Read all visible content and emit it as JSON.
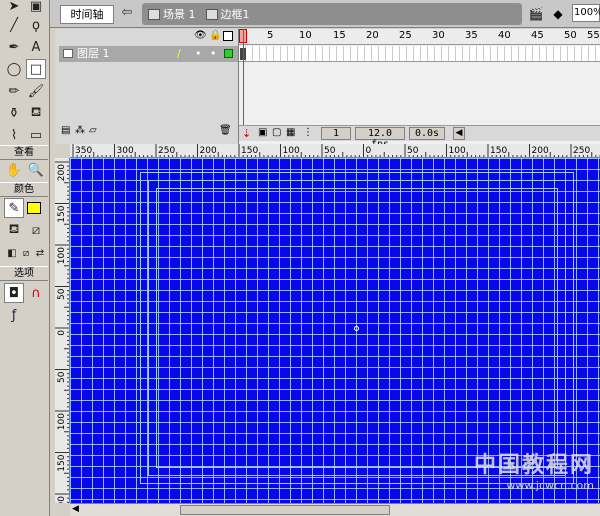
{
  "header": {
    "timeline_button": "时间轴",
    "scene_label": "场景 1",
    "symbol_label": "边框1",
    "zoom": "100%"
  },
  "tools": {
    "view_label": "查看",
    "colors_label": "颜色",
    "options_label": "选项",
    "stroke_color": "#000000",
    "fill_color": "#ffff00"
  },
  "timeline": {
    "layer_name": "图层 1",
    "frame_numbers": [
      "1",
      "5",
      "10",
      "15",
      "20",
      "25",
      "30",
      "35",
      "40",
      "45",
      "50",
      "55"
    ],
    "current_frame": "1",
    "frame_rate": "12.0 fps",
    "elapsed_time": "0.0s"
  },
  "rulers": {
    "top": [
      "350",
      "300",
      "250",
      "200",
      "150",
      "100",
      "50",
      "0",
      "50",
      "100",
      "150",
      "200",
      "250"
    ],
    "left": [
      "200",
      "150",
      "100",
      "50",
      "0",
      "50",
      "100",
      "150",
      "200"
    ]
  },
  "stage": {
    "background_color": "#0808e8",
    "grid_color": "#aad2ff",
    "frame_color": "#9ad0e8"
  },
  "watermark": {
    "text": "中国教程网",
    "url": "www.jcwcn.com"
  }
}
